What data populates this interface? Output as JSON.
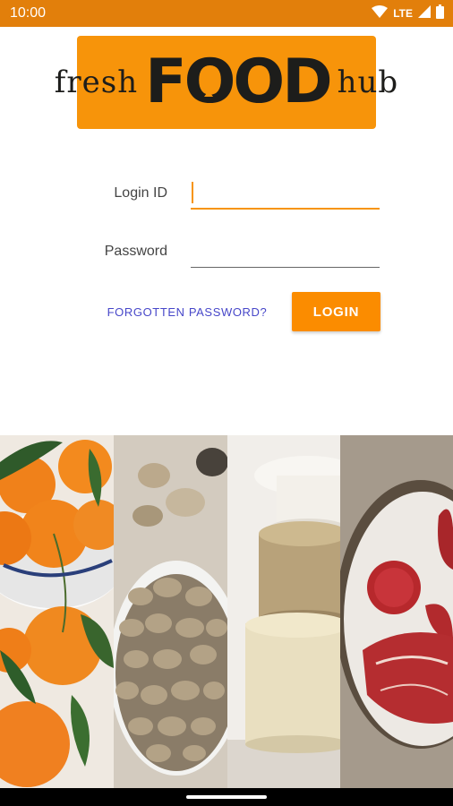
{
  "status_bar": {
    "time": "10:00",
    "network": "LTE",
    "background_color": "#e27f0b"
  },
  "logo": {
    "word_left": "fresh",
    "word_main_f": "F",
    "word_main_d": "D",
    "word_right": "hub",
    "color": "#f7940a"
  },
  "form": {
    "login_label": "Login ID",
    "login_value": "",
    "password_label": "Password",
    "password_value": "",
    "forgot_label": "FORGOTTEN PASSWORD?",
    "login_button": "LOGIN",
    "accent_color": "#fb8c00",
    "link_color": "#4747c9"
  },
  "icons": {
    "wifi": "wifi-icon",
    "signal": "signal-icon",
    "battery": "battery-icon",
    "fish": "fish-icon",
    "apple": "apple-icon"
  },
  "images": [
    "oranges-image",
    "clams-image",
    "cheese-image",
    "meat-image"
  ]
}
